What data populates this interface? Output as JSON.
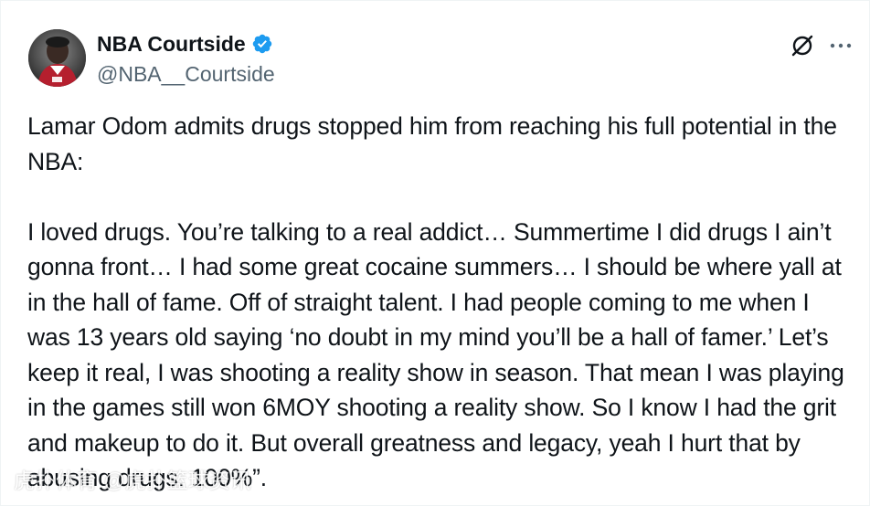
{
  "author": {
    "display_name": "NBA Courtside",
    "handle": "@NBA__Courtside",
    "verified": true,
    "avatar_icon": "avatar-photo",
    "verified_color": "#1d9bf0"
  },
  "actions": {
    "grok_icon": "grok-icon",
    "more_icon": "more-options-icon"
  },
  "tweet": {
    "paragraphs": [
      "Lamar Odom admits drugs stopped him from reaching his full potential in the NBA:",
      "I loved drugs. You’re talking to a real addict… Summertime I did drugs I ain’t gonna front… I had some great cocaine summers… I should be where yall at in the hall of fame. Off of straight talent. I had people coming to me when I was 13 years old saying ‘no doubt in my mind you’ll be a hall of famer.’ Let’s keep it real, I was shooting a reality show in season. That mean I was playing in the games still won 6MOY shooting a reality show. So I know I had the grit and makeup to do it. But overall greatness and legacy, yeah I hurt that by abusing drugs. 100%”."
    ]
  },
  "watermark": {
    "text": "虎扑体育 @虎扑篮球资讯"
  },
  "colors": {
    "text": "#0f1419",
    "secondary": "#536471",
    "background": "#ffffff"
  }
}
